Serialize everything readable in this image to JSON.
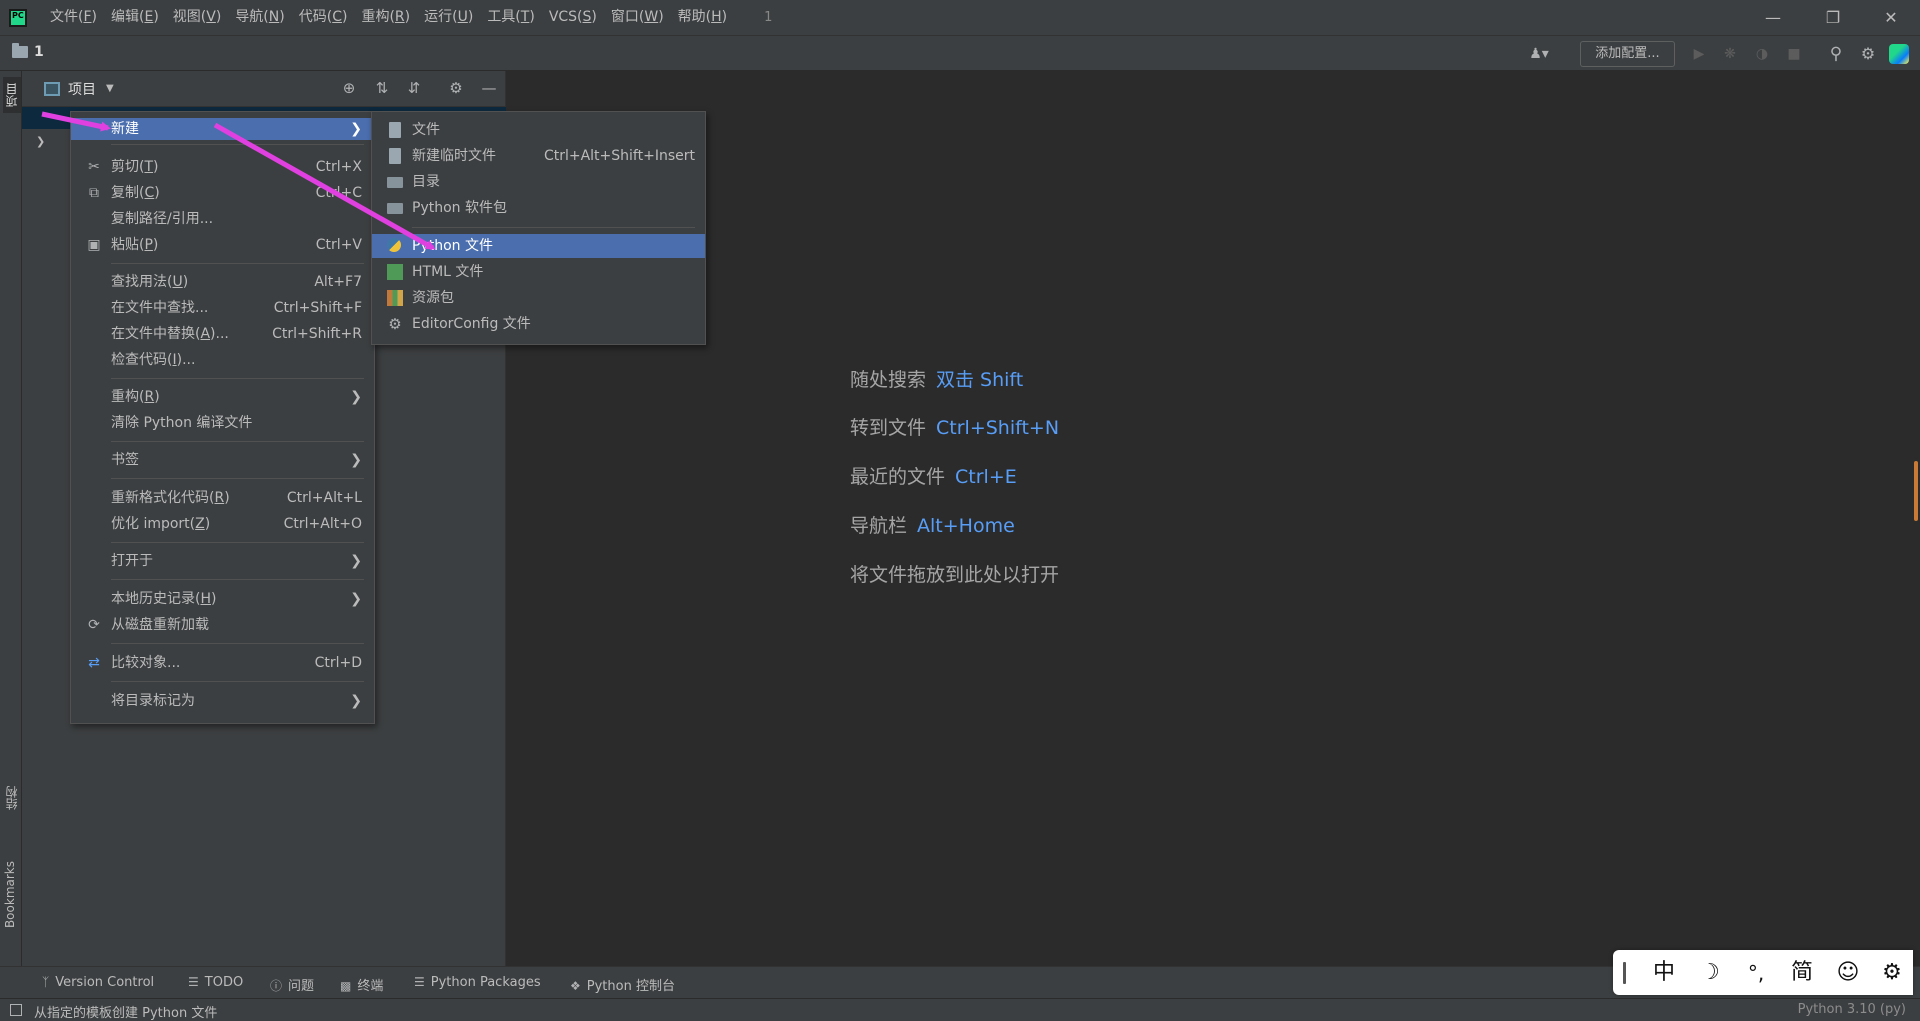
{
  "menubar": {
    "items": [
      {
        "text": "文件(",
        "key": "F",
        "end": ")"
      },
      {
        "text": "编辑(",
        "key": "E",
        "end": ")"
      },
      {
        "text": "视图(",
        "key": "V",
        "end": ")"
      },
      {
        "text": "导航(",
        "key": "N",
        "end": ")"
      },
      {
        "text": "代码(",
        "key": "C",
        "end": ")"
      },
      {
        "text": "重构(",
        "key": "R",
        "end": ")"
      },
      {
        "text": "运行(",
        "key": "U",
        "end": ")"
      },
      {
        "text": "工具(",
        "key": "T",
        "end": ")"
      },
      {
        "text": "VCS(",
        "key": "S",
        "end": ")"
      },
      {
        "text": "窗口(",
        "key": "W",
        "end": ")"
      },
      {
        "text": "帮助(",
        "key": "H",
        "end": ")"
      }
    ],
    "project_number": "1"
  },
  "toolbar": {
    "breadcrumb": "1",
    "add_config": "添加配置..."
  },
  "left_strip": {
    "project_tab": "项目",
    "structure_tab": "结构",
    "bookmarks_tab": "Bookmarks"
  },
  "project_panel": {
    "title": "项目"
  },
  "context_menu": {
    "new": {
      "text": "新建"
    },
    "cut": {
      "text": "剪切(",
      "key": "T",
      "end": ")",
      "shortcut": "Ctrl+X"
    },
    "copy": {
      "text": "复制(",
      "key": "C",
      "end": ")",
      "shortcut": "Ctrl+C"
    },
    "copy_path": {
      "text": "复制路径/引用..."
    },
    "paste": {
      "text": "粘贴(",
      "key": "P",
      "end": ")",
      "shortcut": "Ctrl+V"
    },
    "find_usages": {
      "text": "查找用法(",
      "key": "U",
      "end": ")",
      "shortcut": "Alt+F7"
    },
    "find_in_files": {
      "text": "在文件中查找...",
      "shortcut": "Ctrl+Shift+F"
    },
    "replace_in_files": {
      "text": "在文件中替换(",
      "key": "A",
      "end": ")...",
      "shortcut": "Ctrl+Shift+R"
    },
    "inspect_code": {
      "text": "检查代码(",
      "key": "I",
      "end": ")..."
    },
    "refactor": {
      "text": "重构(",
      "key": "R",
      "end": ")"
    },
    "clean_python": {
      "text": "清除 Python 编译文件"
    },
    "bookmarks": {
      "text": "书签"
    },
    "reformat": {
      "text": "重新格式化代码(",
      "key": "R",
      "end": ")",
      "shortcut": "Ctrl+Alt+L"
    },
    "optimize_imports": {
      "text": "优化 import(",
      "key": "Z",
      "end": ")",
      "shortcut": "Ctrl+Alt+O"
    },
    "open_in": {
      "text": "打开于"
    },
    "local_history": {
      "text": "本地历史记录(",
      "key": "H",
      "end": ")"
    },
    "reload": {
      "text": "从磁盘重新加载"
    },
    "compare_with": {
      "text": "比较对象...",
      "shortcut": "Ctrl+D"
    },
    "mark_directory": {
      "text": "将目录标记为"
    }
  },
  "submenu": {
    "file": "文件",
    "scratch_file": "新建临时文件",
    "scratch_shortcut": "Ctrl+Alt+Shift+Insert",
    "directory": "目录",
    "python_package": "Python 软件包",
    "python_file": "Python 文件",
    "html_file": "HTML 文件",
    "resource_bundle": "资源包",
    "editorconfig": "EditorConfig 文件"
  },
  "editor_hints": [
    {
      "label": "随处搜索",
      "key": "双击 Shift"
    },
    {
      "label": "转到文件",
      "key": "Ctrl+Shift+N"
    },
    {
      "label": "最近的文件",
      "key": "Ctrl+E"
    },
    {
      "label": "导航栏",
      "key": "Alt+Home"
    },
    {
      "label": "将文件拖放到此处以打开",
      "key": ""
    }
  ],
  "bottom_bar": {
    "version_control": "Version Control",
    "todo": "TODO",
    "problems": "问题",
    "terminal": "终端",
    "python_packages": "Python Packages",
    "python_console": "Python 控制台"
  },
  "status_bar": {
    "message": "从指定的模板创建 Python 文件",
    "interpreter": "Python 3.10 (py)"
  },
  "ime": {
    "mode": "中",
    "moon": "☽",
    "punct": "°,",
    "script": "简",
    "emoji": "☺",
    "settings": "⚙"
  },
  "colors": {
    "accent": "#4b6eaf",
    "link": "#589df6",
    "annotation": "#e040e0"
  }
}
